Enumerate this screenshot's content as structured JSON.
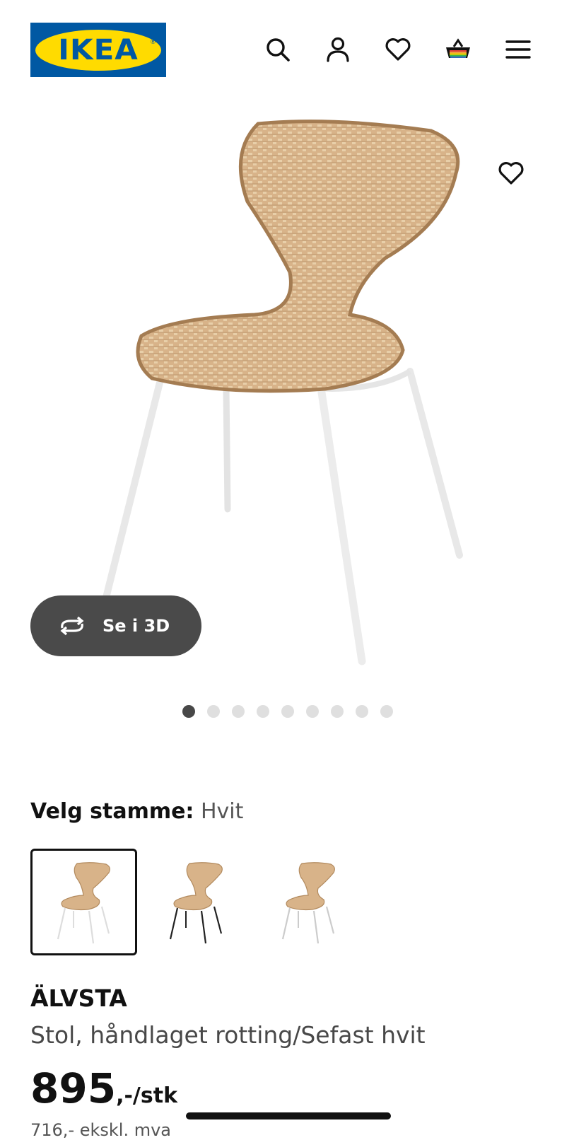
{
  "header": {
    "logo_text": "IKEA",
    "logo_reg": "®",
    "icons": [
      "search-icon",
      "account-icon",
      "heart-icon",
      "basket-icon",
      "menu-icon"
    ]
  },
  "gallery": {
    "button_3d_label": "Se i 3D",
    "dot_count": 9,
    "active_dot": 0
  },
  "variant": {
    "label": "Velg stamme:",
    "value": "Hvit",
    "options": [
      "white-legs",
      "black-legs",
      "white-legs-alt"
    ],
    "selected_index": 0
  },
  "product": {
    "name": "ÄLVSTA",
    "description": "Stol, håndlaget rotting/Sefast hvit",
    "price_amount": "895",
    "price_suffix": ",-/stk",
    "sub_price": "716,- ekskl. mva"
  },
  "colors": {
    "brand_blue": "#0058a3",
    "brand_yellow": "#ffdb00",
    "rattan": "#d8b389",
    "button_dark": "#4a4a4a"
  }
}
